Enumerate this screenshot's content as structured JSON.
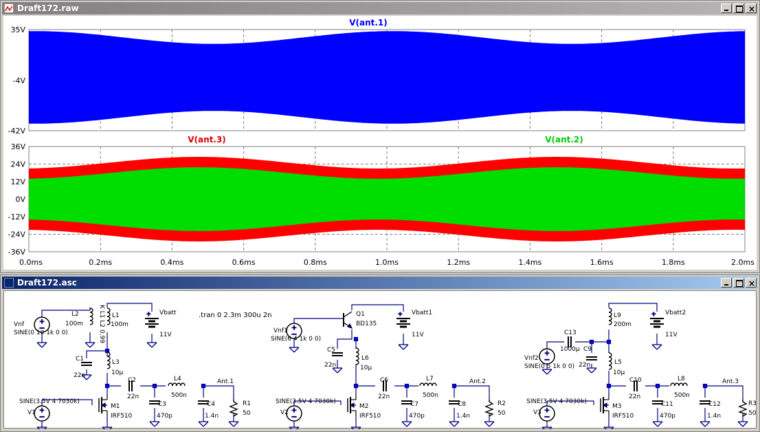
{
  "waveform_window": {
    "title": "Draft172.raw",
    "top_pane": {
      "y_ticks": [
        "35V",
        "-4V",
        "-42V"
      ],
      "trace_label": "V(ant.1)",
      "trace_color": "#0000ff"
    },
    "bottom_pane": {
      "y_ticks": [
        "36V",
        "24V",
        "12V",
        "0V",
        "-12V",
        "-24V",
        "-36V"
      ],
      "trace_labels": [
        {
          "name": "V(ant.3)",
          "color": "#ff0000"
        },
        {
          "name": "V(ant.2)",
          "color": "#00dd00"
        }
      ]
    },
    "x_ticks": [
      "0.0ms",
      "0.2ms",
      "0.4ms",
      "0.6ms",
      "0.8ms",
      "1.0ms",
      "1.2ms",
      "1.4ms",
      "1.6ms",
      "1.8ms",
      "2.0ms"
    ]
  },
  "schematic_window": {
    "title": "Draft172.asc",
    "directive": ".tran 0 2.3m 300u 2n",
    "circuit1": {
      "src_name": "Vnf",
      "src_value": "SINE(0 10 1k 0 0)",
      "l2": "L2",
      "l2_val": "100m",
      "coupling": "K L1 L2 0.99",
      "l1": "L1",
      "l1_val": "100m",
      "batt": "Vbatt",
      "batt_val": "11V",
      "c1": "C1",
      "c1_val": "22n",
      "l3": "L3",
      "l3_val": "10µ",
      "c2": "C2",
      "c2_val": "22n",
      "l4": "L4",
      "l4_val": "500n",
      "net": "Ant.1",
      "r1": "R1",
      "r1_val": "50",
      "c3": "C3",
      "c3_val": "470p",
      "c4": "C4",
      "c4_val": "1.4n",
      "gate_src": "SINE(3.5V 4 7030k)",
      "v1": "V1",
      "m1": "M1",
      "m1_model": "IRF510"
    },
    "circuit2": {
      "q1": "Q1",
      "q1_model": "BD135",
      "src_name": "Vnf1",
      "src_value": "SINE(6 4 1k 0 0)",
      "batt": "Vbatt1",
      "batt_val": "11V",
      "c5": "C5",
      "c5_val": "22n",
      "l6": "L6",
      "l6_val": "10µ",
      "c6": "C6",
      "c6_val": "22n",
      "l7": "L7",
      "l7_val": "500n",
      "net": "Ant.2",
      "r2": "R2",
      "r2_val": "50",
      "c7": "C7",
      "c7_val": "470p",
      "c8": "C8",
      "c8_val": "1.4n",
      "gate_src": "SINE(3.5V 4 7030k)",
      "v2": "V2",
      "m2": "M2",
      "m2_model": "IRF510"
    },
    "circuit3": {
      "l9": "L9",
      "l9_val": "200m",
      "batt": "Vbatt2",
      "batt_val": "11V",
      "c13": "C13",
      "c13_val": "1000µ",
      "c9": "C9",
      "c9_val": "22n",
      "src_name": "Vnf2",
      "src_value": "SINE(0 5 1k 0 0)",
      "l5": "L5",
      "l5_val": "10µ",
      "c10": "C10",
      "c10_val": "22n",
      "l8": "L8",
      "l8_val": "500n",
      "net": "Ant.3",
      "r3": "R3",
      "r3_val": "50",
      "c11": "C11",
      "c11_val": "470p",
      "c12": "C12",
      "c12_val": "1.4n",
      "gate_src": "SINE(3.5V 4 7030k)",
      "v3": "V3",
      "m3": "M3",
      "m3_model": "IRF510"
    }
  }
}
